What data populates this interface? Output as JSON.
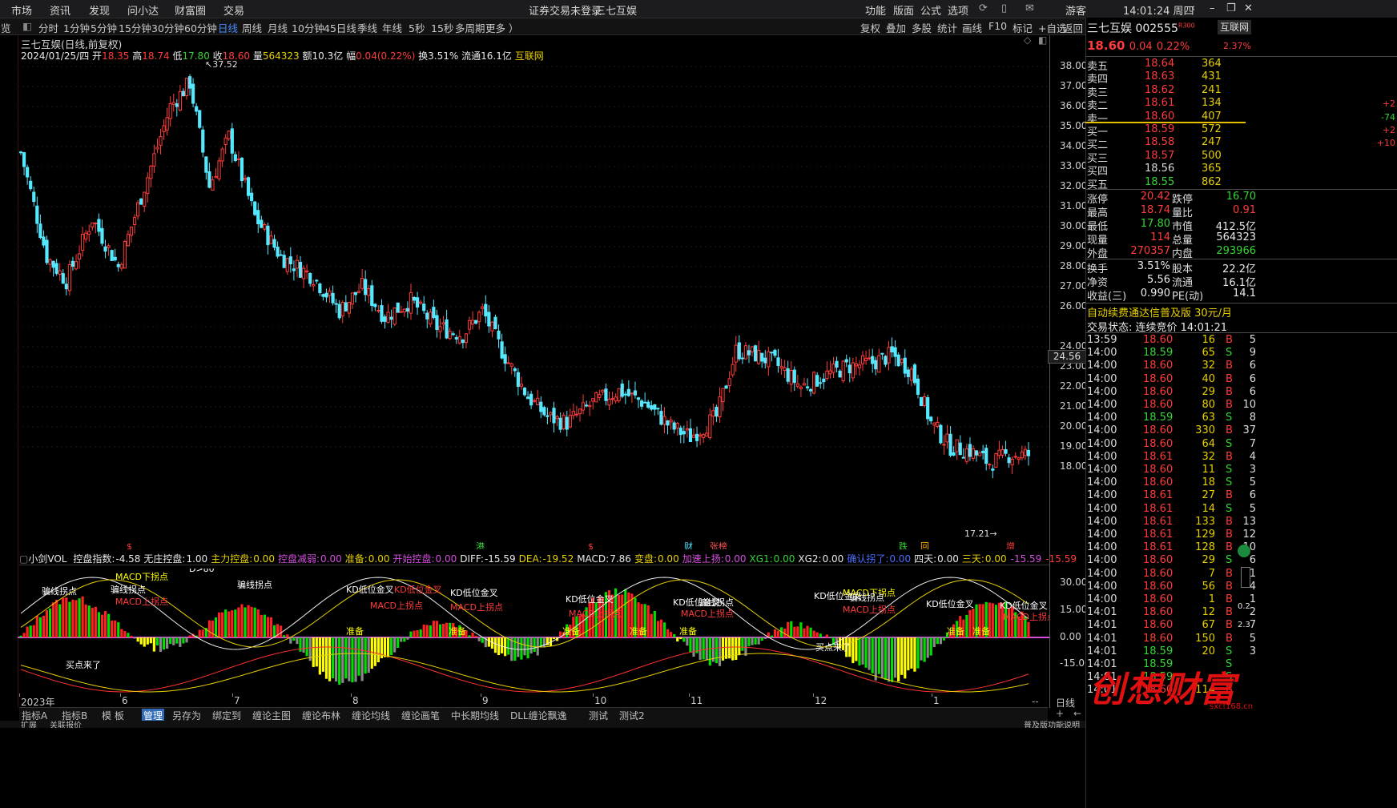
{
  "menu": {
    "items": [
      "市场",
      "资讯",
      "发现",
      "问小达",
      "财富圈",
      "交易"
    ],
    "notice": "证券交易未登录",
    "notice_stock": "三七互娱",
    "right_items": [
      "功能",
      "版面",
      "公式",
      "选项"
    ],
    "user": "游客",
    "clock": "14:01:24 周四"
  },
  "toolbar": {
    "items": [
      "分时",
      "1分钟",
      "5分钟",
      "15分钟",
      "30分钟",
      "60分钟",
      "日线",
      "周线",
      "月线",
      "10分钟",
      "45日线",
      "季线",
      "年线",
      "5秒",
      "15秒",
      "多周期",
      "更多 ）"
    ],
    "active": "日线",
    "right": [
      "复权",
      "叠加",
      "多股",
      "统计",
      "画线",
      "F10",
      "标记",
      "+自选",
      "返回"
    ],
    "left_label": "览"
  },
  "chart": {
    "title": "三七互娱(日线,前复权)",
    "date": "2024/01/25/四",
    "ohlc": {
      "open_label": "开",
      "open": "18.35",
      "high_label": "高",
      "high": "18.74",
      "low_label": "低",
      "low": "17.80",
      "close_label": "收",
      "close": "18.60",
      "vol_label": "量",
      "vol": "564323",
      "amt_label": "额",
      "amt": "10.3亿",
      "chg_label": "幅",
      "chg": "0.04(0.22%)",
      "turn_label": "换",
      "turn": "3.51%",
      "float_label": "流通",
      "float": "16.1亿",
      "source": "互联网"
    },
    "price_ticks": [
      "38.00",
      "37.00",
      "36.00",
      "35.00",
      "34.00",
      "33.00",
      "32.00",
      "31.00",
      "30.00",
      "29.00",
      "28.00",
      "27.00",
      "26.00",
      "24.00",
      "23.00",
      "22.00",
      "21.00",
      "20.00",
      "19.00",
      "18.00"
    ],
    "current_tag": "24.56",
    "high_mark": "37.52",
    "low_mark": "17.21",
    "event_markers": [
      "$",
      "港",
      "$",
      "财",
      "张榜",
      "跌",
      "回",
      "增"
    ],
    "month_labels": [
      "2023年",
      "6",
      "7",
      "8",
      "9",
      "10",
      "11",
      "12",
      "1"
    ]
  },
  "indicator": {
    "name": "小剑VOL",
    "pairs": [
      {
        "k": "控盘指数:",
        "v": "-4.58",
        "c": "white"
      },
      {
        "k": "无庄控盘:",
        "v": "1.00",
        "c": "white"
      },
      {
        "k": "主力控盘:",
        "v": "0.00",
        "c": "yellow"
      },
      {
        "k": "控盘减弱:",
        "v": "0.00",
        "c": "magenta"
      },
      {
        "k": "准备:",
        "v": "0.00",
        "c": "yellow"
      },
      {
        "k": "开始控盘:",
        "v": "0.00",
        "c": "magenta"
      },
      {
        "k": "DIFF:",
        "v": "-15.59",
        "c": "white"
      },
      {
        "k": "DEA:",
        "v": "-19.52",
        "c": "yellow"
      },
      {
        "k": "MACD:",
        "v": "7.86",
        "c": "white"
      },
      {
        "k": "变盘:",
        "v": "0.00",
        "c": "yellow"
      },
      {
        "k": "加速上扬:",
        "v": "0.00",
        "c": "magenta"
      },
      {
        "k": "XG1:",
        "v": "0.00",
        "c": "green"
      },
      {
        "k": "XG2:",
        "v": "0.00",
        "c": "white"
      },
      {
        "k": "确认拐了:",
        "v": "0.00",
        "c": "blue"
      },
      {
        "k": "四天:",
        "v": "0.00",
        "c": "white"
      },
      {
        "k": "三天:",
        "v": "0.00",
        "c": "yellow"
      },
      {
        "k": "",
        "v": "-15.59",
        "c": "magenta"
      },
      {
        "k": "",
        "v": "-15.59",
        "c": "red"
      }
    ],
    "ticks": [
      "30.00",
      "15.00",
      "0.00",
      "-15.00"
    ],
    "labels": [
      "骗线拐点",
      "MACD下拐点",
      "骗线拐点",
      "MACD上拐点",
      "D>80",
      "骗线拐点",
      "KD低位金叉",
      "KD低位金叉",
      "MACD上拐点",
      "KD低位金叉",
      "MACD上拐点",
      "KD低位金叉",
      "MACD上拐点",
      "KD低位金叉",
      "骗线拐点",
      "MACD上拐点",
      "KD低位金叉",
      "MACD下拐点",
      "骗线拐点",
      "MACD上拐点",
      "KD低位金叉",
      "KD低位金叉",
      "MACD上拐点",
      "买点来了",
      "买点来了",
      "准备",
      "准备",
      "准备",
      "准备",
      "准备",
      "准备",
      "准备"
    ]
  },
  "bottom_tabs": {
    "items": [
      "指标A",
      "指标B",
      "模 板",
      "管理",
      "另存为",
      "绑定到",
      "缠论主图",
      "缠论布林",
      "缠论均线",
      "缠论画笔",
      "中长期均线",
      "DLL缠论飘逸",
      "测试",
      "测试2"
    ],
    "active": "管理",
    "period": "日线"
  },
  "quote": {
    "name": "三七互娱",
    "code": "002555",
    "tag": "R300",
    "source": "互联网",
    "price": "18.60",
    "change": "0.04",
    "pct": "0.22%",
    "side_pct": "2.37%",
    "asks": [
      {
        "l": "卖五",
        "p": "18.64",
        "v": "364",
        "d": ""
      },
      {
        "l": "卖四",
        "p": "18.63",
        "v": "431",
        "d": ""
      },
      {
        "l": "卖三",
        "p": "18.62",
        "v": "241",
        "d": ""
      },
      {
        "l": "卖二",
        "p": "18.61",
        "v": "134",
        "d": "+2"
      },
      {
        "l": "卖一",
        "p": "18.60",
        "v": "407",
        "d": "-74"
      }
    ],
    "bids": [
      {
        "l": "买一",
        "p": "18.59",
        "v": "572",
        "d": "+2"
      },
      {
        "l": "买二",
        "p": "18.58",
        "v": "247",
        "d": "+10"
      },
      {
        "l": "买三",
        "p": "18.57",
        "v": "500",
        "d": ""
      },
      {
        "l": "买四",
        "p": "18.56",
        "v": "365",
        "d": ""
      },
      {
        "l": "买五",
        "p": "18.55",
        "v": "862",
        "d": ""
      }
    ],
    "stats": [
      [
        "涨停",
        "20.42",
        "red",
        "跌停",
        "16.70",
        "green"
      ],
      [
        "最高",
        "18.74",
        "red",
        "量比",
        "0.91",
        "red"
      ],
      [
        "最低",
        "17.80",
        "green",
        "市值",
        "412.5亿",
        "white"
      ],
      [
        "现量",
        "114",
        "red",
        "总量",
        "564323",
        "white"
      ],
      [
        "外盘",
        "270357",
        "red",
        "内盘",
        "293966",
        "green"
      ]
    ],
    "stats2": [
      [
        "换手",
        "3.51%",
        "white",
        "股本",
        "22.2亿",
        "white"
      ],
      [
        "净资",
        "5.56",
        "white",
        "流通",
        "16.1亿",
        "white"
      ],
      [
        "收益(三)",
        "0.990",
        "white",
        "PE(动)",
        "14.1",
        "white"
      ]
    ],
    "ad": "自动续费通达信普及版  30元/月",
    "state": "交易状态: 连续竞价 14:01:21",
    "ticks": [
      [
        "13:59",
        "18.60",
        "16",
        "B",
        "5"
      ],
      [
        "14:00",
        "18.59",
        "65",
        "S",
        "9"
      ],
      [
        "14:00",
        "18.60",
        "32",
        "B",
        "6"
      ],
      [
        "14:00",
        "18.60",
        "40",
        "B",
        "6"
      ],
      [
        "14:00",
        "18.60",
        "29",
        "B",
        "6"
      ],
      [
        "14:00",
        "18.60",
        "80",
        "B",
        "10"
      ],
      [
        "14:00",
        "18.59",
        "63",
        "S",
        "8"
      ],
      [
        "14:00",
        "18.60",
        "330",
        "B",
        "37"
      ],
      [
        "14:00",
        "18.60",
        "64",
        "S",
        "7"
      ],
      [
        "14:00",
        "18.61",
        "32",
        "B",
        "4"
      ],
      [
        "14:00",
        "18.60",
        "11",
        "S",
        "3"
      ],
      [
        "14:00",
        "18.60",
        "18",
        "S",
        "5"
      ],
      [
        "14:00",
        "18.61",
        "27",
        "B",
        "6"
      ],
      [
        "14:00",
        "18.61",
        "14",
        "S",
        "5"
      ],
      [
        "14:00",
        "18.61",
        "133",
        "B",
        "13"
      ],
      [
        "14:00",
        "18.61",
        "129",
        "B",
        "12"
      ],
      [
        "14:00",
        "18.61",
        "128",
        "B",
        "10"
      ],
      [
        "14:00",
        "18.60",
        "29",
        "S",
        "6"
      ],
      [
        "14:00",
        "18.60",
        "7",
        "B",
        "1"
      ],
      [
        "14:00",
        "18.60",
        "56",
        "B",
        "4"
      ],
      [
        "14:00",
        "18.60",
        "1",
        "B",
        "1"
      ],
      [
        "14:01",
        "18.60",
        "12",
        "B",
        "2"
      ],
      [
        "14:01",
        "18.60",
        "67",
        "B",
        "7"
      ],
      [
        "14:01",
        "18.60",
        "150",
        "B",
        "5"
      ],
      [
        "14:01",
        "18.59",
        "20",
        "S",
        "3"
      ],
      [
        "14:01",
        "18.59",
        "",
        "S",
        ""
      ],
      [
        "14:01",
        "18.59",
        "",
        "S",
        ""
      ],
      [
        "14:01",
        "18.60",
        "114",
        "B",
        ""
      ]
    ],
    "watermark": "创想财富",
    "watermark_url": "sxcf168.cn"
  },
  "status": {
    "left": [
      "扩展",
      "关联报价"
    ],
    "right": "普及版功能说明"
  }
}
